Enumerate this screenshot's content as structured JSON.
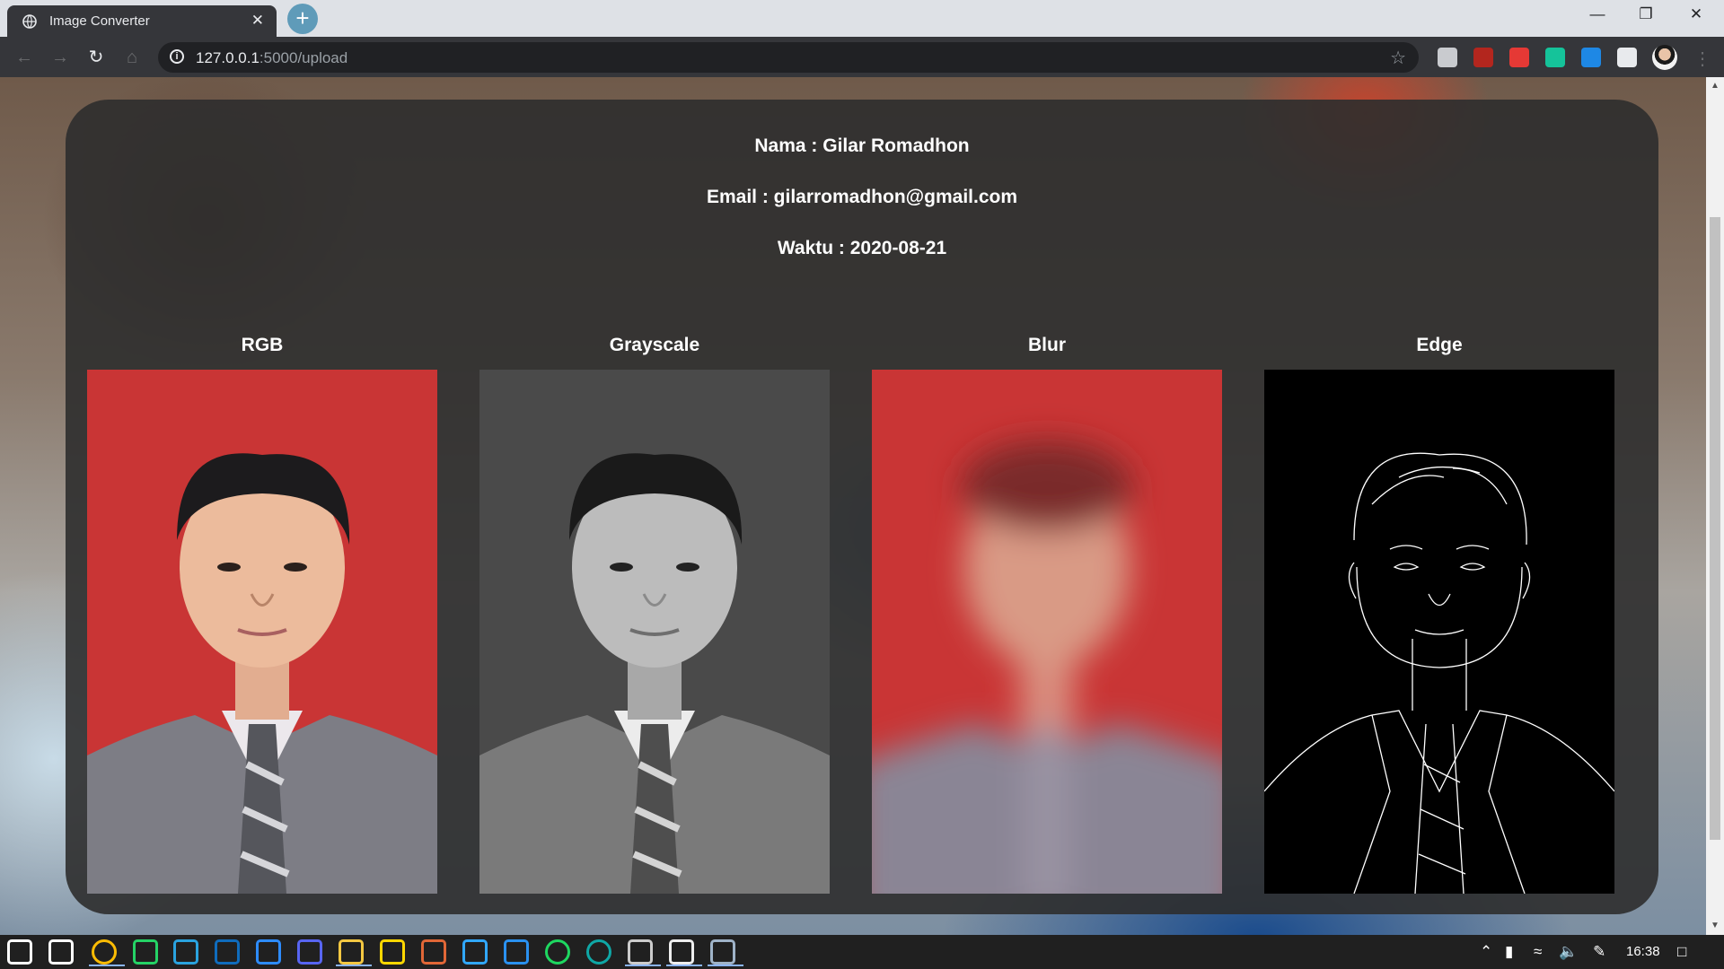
{
  "browser": {
    "tab_title": "Image Converter",
    "tab_close": "✕",
    "new_tab": "+",
    "url_host": "127.0.0.1",
    "url_path": ":5000/upload",
    "window_controls": [
      "—",
      "❐",
      "✕"
    ],
    "nav_icons": [
      "arrow-left-icon",
      "arrow-right-icon",
      "reload-icon",
      "home-icon",
      "info-icon",
      "star-icon"
    ],
    "extensions": [
      {
        "name": "ext-generic-icon",
        "color": "#c9cbcf"
      },
      {
        "name": "ext-pdf-icon",
        "color": "#b3261e"
      },
      {
        "name": "ext-video-icon",
        "color": "#e53935"
      },
      {
        "name": "ext-grammarly-icon",
        "color": "#15c39a"
      },
      {
        "name": "ext-download-icon",
        "color": "#1e88e5"
      },
      {
        "name": "extensions-puzzle-icon",
        "color": "#e8eaed"
      }
    ]
  },
  "page": {
    "nama": "Nama : Gilar Romadhon",
    "email": "Email : gilarromadhon@gmail.com",
    "waktu": "Waktu : 2020-08-21",
    "panels": [
      {
        "title": "RGB",
        "icon": "rgb-photo",
        "bg": "#c93535"
      },
      {
        "title": "Grayscale",
        "icon": "grayscale-photo",
        "bg": "#4a4a4a"
      },
      {
        "title": "Blur",
        "icon": "blur-photo",
        "bg": "#c93535"
      },
      {
        "title": "Edge",
        "icon": "edge-photo",
        "bg": "#000000"
      }
    ]
  },
  "taskbar": {
    "time": "16:38",
    "apps": [
      {
        "name": "windows-start-icon",
        "color": "#ffffff"
      },
      {
        "name": "task-view-icon",
        "color": "#ffffff"
      },
      {
        "name": "chrome-icon",
        "color": "#fbbc04"
      },
      {
        "name": "whatsapp-icon",
        "color": "#25d366"
      },
      {
        "name": "telegram-icon",
        "color": "#2aa3df"
      },
      {
        "name": "mail-icon",
        "color": "#0f6cbd"
      },
      {
        "name": "zoom-icon",
        "color": "#2d8cff"
      },
      {
        "name": "discord-icon",
        "color": "#5865f2"
      },
      {
        "name": "file-explorer-icon",
        "color": "#f4c842"
      },
      {
        "name": "sticky-notes-icon",
        "color": "#ffd700"
      },
      {
        "name": "matlab-icon",
        "color": "#e16737"
      },
      {
        "name": "photoshop-icon",
        "color": "#31a8ff"
      },
      {
        "name": "vscode-icon",
        "color": "#2a91f0"
      },
      {
        "name": "spotify-icon",
        "color": "#1ed760"
      },
      {
        "name": "edge-icon",
        "color": "#0fa7a6"
      },
      {
        "name": "terminal-icon",
        "color": "#cccccc"
      },
      {
        "name": "notepad-icon",
        "color": "#eeeeee"
      },
      {
        "name": "python-idle-icon",
        "color": "#9fb3c8"
      }
    ],
    "tray": [
      "chevron-up-icon",
      "battery-icon",
      "wifi-icon",
      "volume-icon",
      "pen-icon",
      "notification-icon"
    ]
  }
}
